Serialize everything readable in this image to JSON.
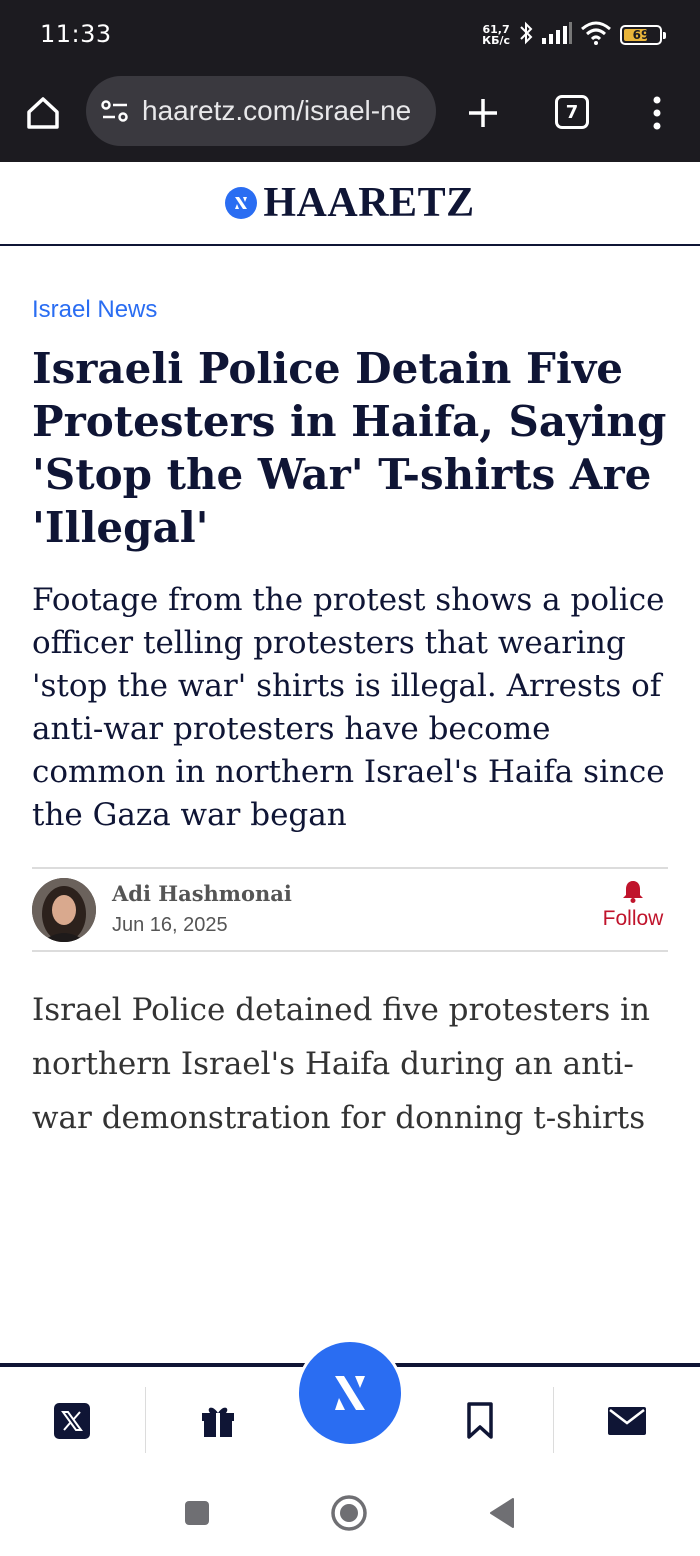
{
  "status_bar": {
    "time": "11:33",
    "net_speed_value": "61,7",
    "net_speed_unit": "КБ/с",
    "battery_level": 69,
    "battery_text": "69"
  },
  "browser": {
    "url": "haaretz.com/israel-ne",
    "tab_count": "7"
  },
  "site": {
    "logo_text": "HAARETZ",
    "accent_color": "#2a6df2",
    "dark_color": "#0f1535"
  },
  "article": {
    "section": "Israel News",
    "headline": "Israeli Police Detain Five Protesters in Haifa, Saying 'Stop the War' T-shirts Are 'Illegal'",
    "subheadline": "Footage from the protest shows a police officer telling protesters that wearing 'stop the war' shirts is illegal. Arrests of anti-war protesters have become common in northern Israel's Haifa since the Gaza war began",
    "author": "Adi Hashmonai",
    "date": "Jun 16, 2025",
    "follow_label": "Follow",
    "body_preview": "Israel Police detained five protesters in northern Israel's Haifa during an anti-war demonstration for donning t-shirts"
  },
  "bottom_bar": {
    "items": [
      "x-icon",
      "gift-icon",
      "haaretz-logo-icon",
      "bookmark-icon",
      "mail-icon"
    ]
  },
  "nav": {
    "buttons": [
      "recents-square-icon",
      "home-circle-icon",
      "back-triangle-icon"
    ]
  }
}
